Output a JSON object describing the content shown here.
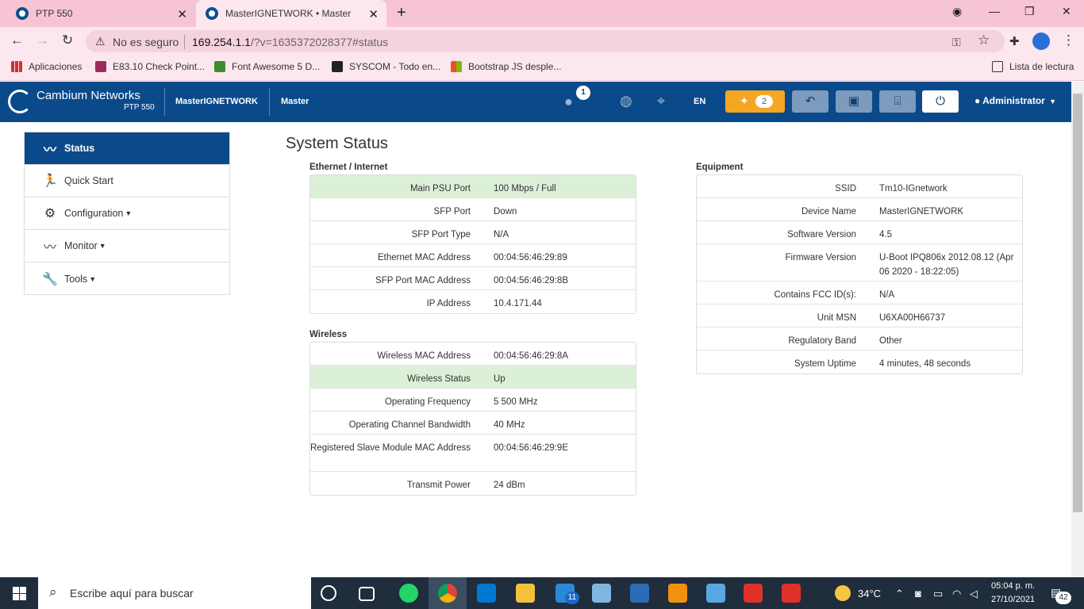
{
  "browser": {
    "tabs": [
      {
        "title": "PTP 550"
      },
      {
        "title": "MasterIGNETWORK • Master"
      }
    ],
    "security_label": "No es seguro",
    "url_host": "169.254.1.1",
    "url_rest": "/?v=1635372028377#status",
    "bookmarks": [
      {
        "label": "Aplicaciones"
      },
      {
        "label": "E83.10 Check Point..."
      },
      {
        "label": "Font Awesome 5 D..."
      },
      {
        "label": "SYSCOM - Todo en..."
      },
      {
        "label": "Bootstrap JS desple..."
      }
    ],
    "reading_list": "Lista de lectura"
  },
  "header": {
    "brand": "Cambium Networks",
    "model": "PTP 550",
    "device_name": "MasterIGNETWORK",
    "device_mode": "Master",
    "user_badge": "1",
    "language": "EN",
    "alerts_count": "2",
    "user": "Administrator"
  },
  "sidebar": {
    "items": [
      {
        "label": "Status",
        "icon": "pulse-icon"
      },
      {
        "label": "Quick Start",
        "icon": "running-icon"
      },
      {
        "label": "Configuration",
        "icon": "gear-icon"
      },
      {
        "label": "Monitor",
        "icon": "pulse-icon"
      },
      {
        "label": "Tools",
        "icon": "wrench-icon"
      }
    ]
  },
  "page": {
    "title": "System Status",
    "ethernet": {
      "heading": "Ethernet / Internet",
      "rows": [
        {
          "k": "Main PSU Port",
          "v": "100 Mbps / Full"
        },
        {
          "k": "SFP Port",
          "v": "Down"
        },
        {
          "k": "SFP Port Type",
          "v": "N/A"
        },
        {
          "k": "Ethernet MAC Address",
          "v": "00:04:56:46:29:89"
        },
        {
          "k": "SFP Port MAC Address",
          "v": "00:04:56:46:29:8B"
        },
        {
          "k": "IP Address",
          "v": "10.4.171.44"
        }
      ]
    },
    "wireless": {
      "heading": "Wireless",
      "rows": [
        {
          "k": "Wireless MAC Address",
          "v": "00:04:56:46:29:8A"
        },
        {
          "k": "Wireless Status",
          "v": "Up"
        },
        {
          "k": "Operating Frequency",
          "v": "5 500 MHz"
        },
        {
          "k": "Operating Channel Bandwidth",
          "v": "40 MHz"
        },
        {
          "k": "Registered Slave Module MAC Address",
          "v": "00:04:56:46:29:9E"
        },
        {
          "k": "Transmit Power",
          "v": "24 dBm"
        }
      ]
    },
    "equipment": {
      "heading": "Equipment",
      "rows": [
        {
          "k": "SSID",
          "v": "Tm10-IGnetwork"
        },
        {
          "k": "Device Name",
          "v": "MasterIGNETWORK"
        },
        {
          "k": "Software Version",
          "v": "4.5"
        },
        {
          "k": "Firmware Version",
          "v": "U-Boot IPQ806x 2012.08.12 (Apr 06 2020 - 18:22:05)"
        },
        {
          "k": "Contains FCC ID(s):",
          "v": "N/A"
        },
        {
          "k": "Unit MSN",
          "v": "U6XA00H66737"
        },
        {
          "k": "Regulatory Band",
          "v": "Other"
        },
        {
          "k": "System Uptime",
          "v": "4 minutes, 48 seconds"
        }
      ]
    }
  },
  "taskbar": {
    "search_placeholder": "Escribe aquí para buscar",
    "temperature": "34°C",
    "time": "05:04 p. m.",
    "date": "27/10/2021",
    "notifications": "42",
    "app_badge": "11"
  },
  "colors": {
    "header_bg": "#0b4a8a",
    "alert": "#f5a623",
    "highlight_row": "#dcf0d8",
    "tab_strip": "#f7c4d3"
  }
}
